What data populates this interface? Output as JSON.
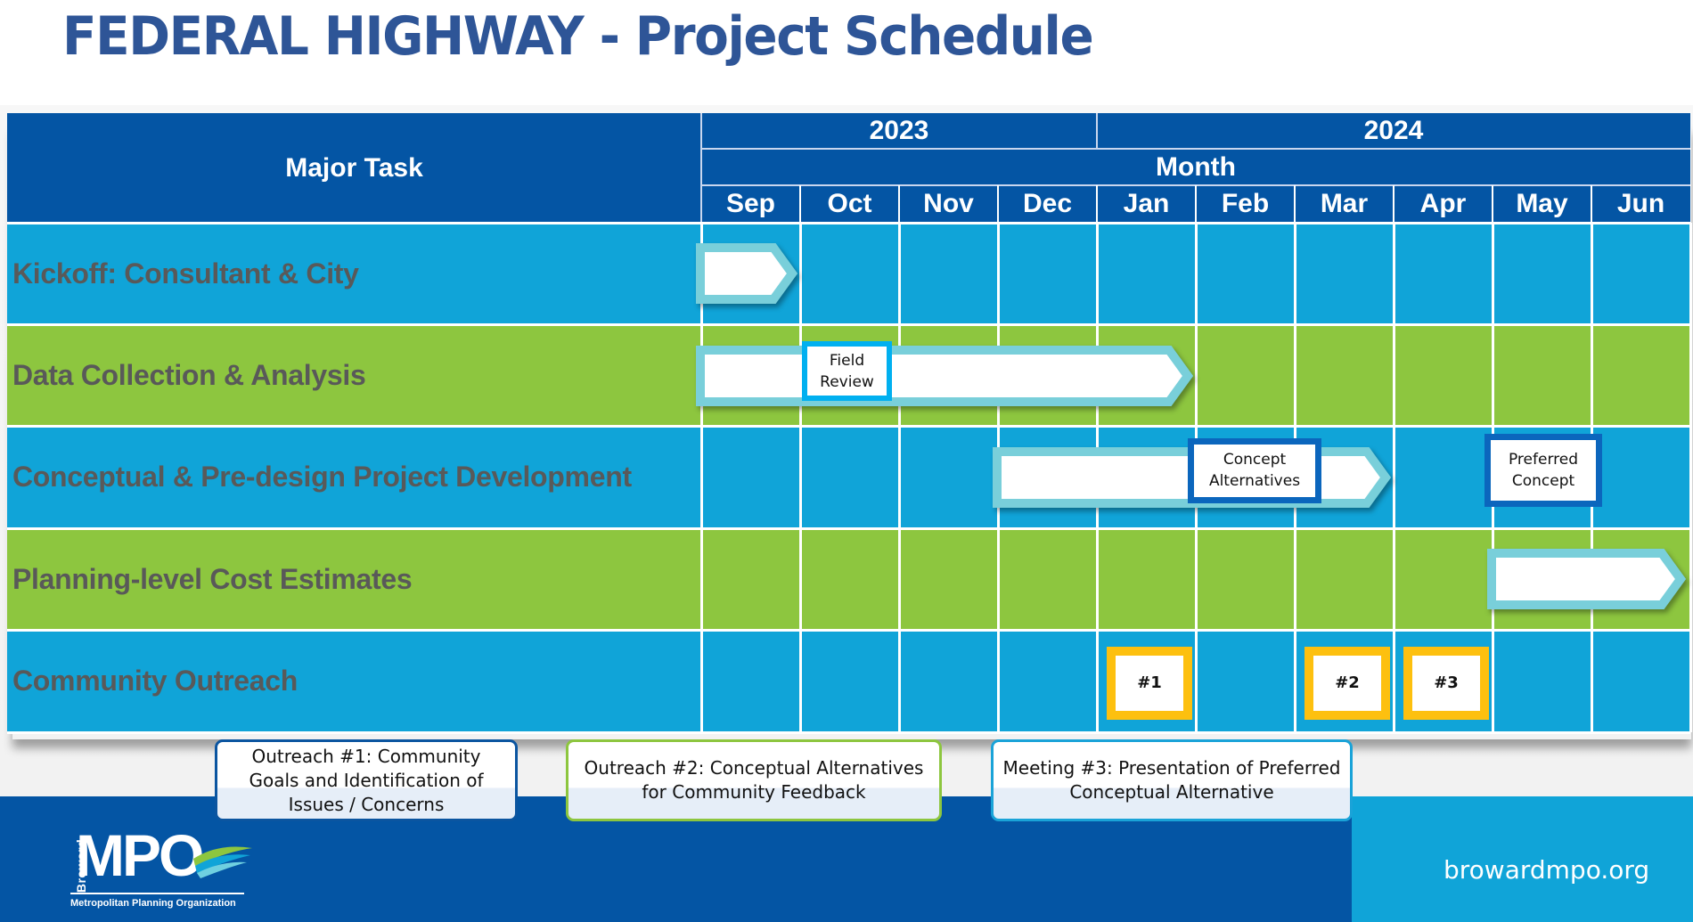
{
  "title": "FEDERAL HIGHWAY - Project Schedule",
  "colors": {
    "title": "#2e5597",
    "header_bg": "#0455a4",
    "row_blue": "#10a4d8",
    "row_green": "#8dc63f",
    "task_text": "#595959",
    "arrow_border": "#79cfda",
    "milestone_light_border": "#00b0f0",
    "milestone_dark_border": "#0b66bd",
    "outreach_border": "#fdc00f"
  },
  "header": {
    "task_column": "Major Task",
    "month_label": "Month",
    "years": [
      {
        "label": "2023",
        "months": 4
      },
      {
        "label": "2024",
        "months": 6
      }
    ],
    "months": [
      "Sep",
      "Oct",
      "Nov",
      "Dec",
      "Jan",
      "Feb",
      "Mar",
      "Apr",
      "May",
      "Jun"
    ]
  },
  "chart_data": {
    "type": "gantt",
    "title": "FEDERAL HIGHWAY - Project Schedule",
    "x_categories": [
      "Sep 2023",
      "Oct 2023",
      "Nov 2023",
      "Dec 2023",
      "Jan 2024",
      "Feb 2024",
      "Mar 2024",
      "Apr 2024",
      "May 2024",
      "Jun 2024"
    ],
    "tasks": [
      {
        "name": "Kickoff: Consultant & City",
        "row_color": "blue",
        "bars": [
          {
            "start_month": "Sep",
            "end_month": "Sep"
          }
        ],
        "milestones": []
      },
      {
        "name": "Data Collection & Analysis",
        "row_color": "green",
        "bars": [
          {
            "start_month": "Sep",
            "end_month": "Jan"
          }
        ],
        "milestones": [
          {
            "label": "Field Review",
            "month": "Oct",
            "style": "light"
          }
        ]
      },
      {
        "name": "Conceptual & Pre-design Project Development",
        "row_color": "blue",
        "bars": [
          {
            "start_month": "Dec",
            "end_month": "Mar"
          }
        ],
        "milestones": [
          {
            "label": "Concept Alternatives",
            "month": "Feb",
            "style": "dark"
          },
          {
            "label": "Preferred Concept",
            "month": "May",
            "style": "dark"
          }
        ]
      },
      {
        "name": "Planning-level Cost Estimates",
        "row_color": "green",
        "bars": [
          {
            "start_month": "May",
            "end_month": "Jun"
          }
        ],
        "milestones": []
      },
      {
        "name": "Community Outreach",
        "row_color": "blue",
        "bars": [],
        "milestones": [
          {
            "label": "#1",
            "month": "Jan",
            "style": "yellow"
          },
          {
            "label": "#2",
            "month": "Mar",
            "style": "yellow"
          },
          {
            "label": "#3",
            "month": "Apr",
            "style": "yellow"
          }
        ]
      }
    ]
  },
  "callouts": [
    {
      "text": "Outreach #1: Community Goals and Identification of Issues / Concerns",
      "border": "#0b55a0"
    },
    {
      "text": "Outreach #2: Conceptual Alternatives for Community Feedback",
      "border": "#8dc63f"
    },
    {
      "text": "Meeting #3: Presentation of Preferred Conceptual Alternative",
      "border": "#1aa3d8"
    }
  ],
  "footer": {
    "logo_vertical": "Broward",
    "logo_main": "MPO",
    "logo_subtitle": "Metropolitan Planning Organization",
    "url": "browardmpo.org"
  }
}
